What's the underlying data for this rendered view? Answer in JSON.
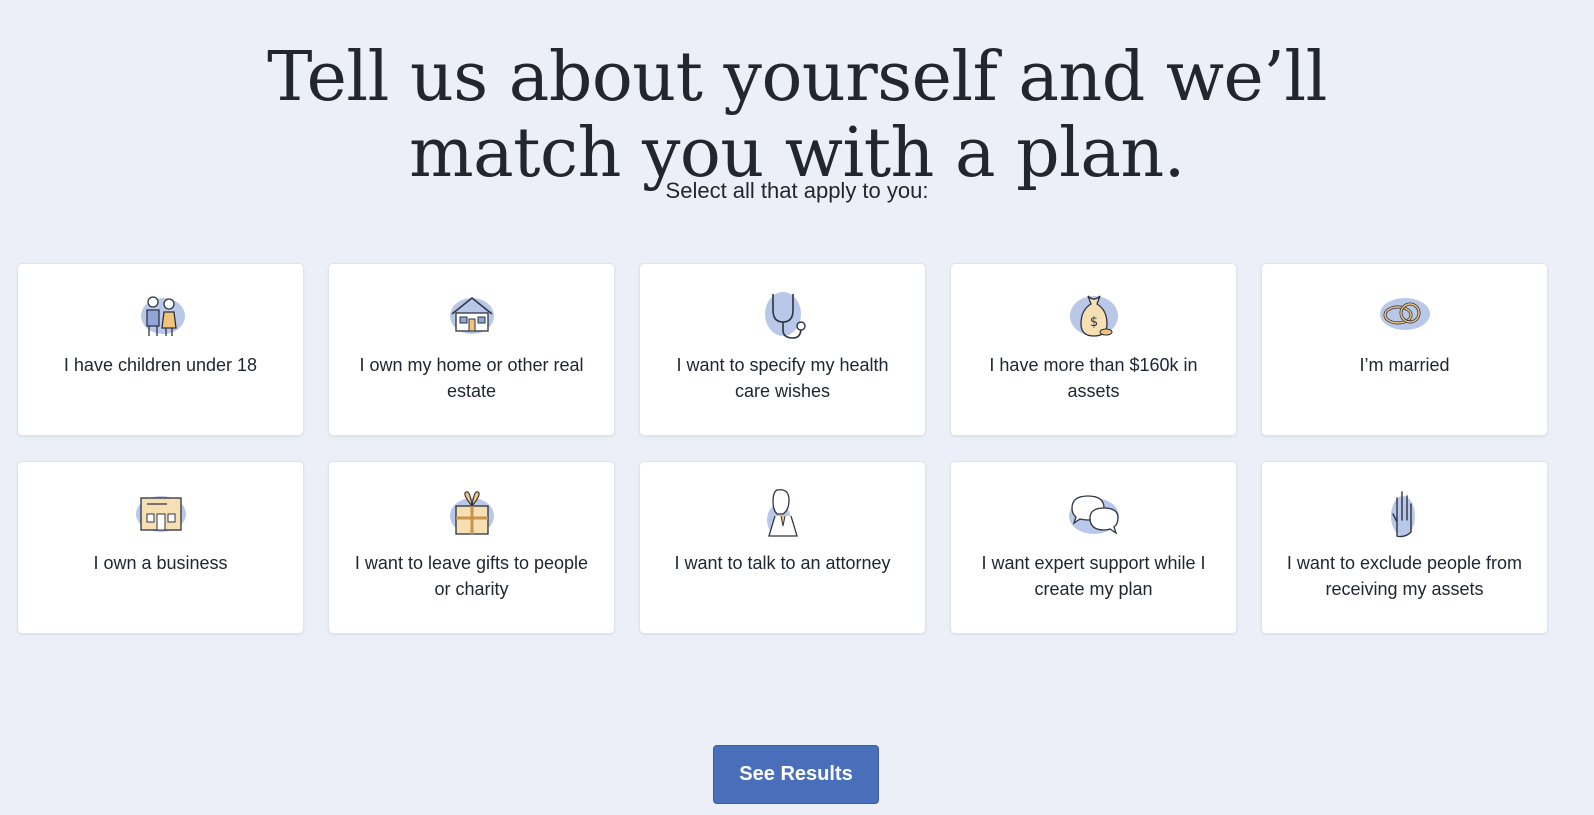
{
  "header": {
    "title_line1": "Tell us about yourself and we’ll",
    "title_line2": "match you with a plan.",
    "subtitle": "Select all that apply to you:"
  },
  "options": [
    {
      "label": "I have children under 18",
      "icon": "children-icon"
    },
    {
      "label": "I own my home or other real estate",
      "icon": "house-icon"
    },
    {
      "label": "I want to specify my health care wishes",
      "icon": "stethoscope-icon"
    },
    {
      "label": "I have more than $160k in assets",
      "icon": "money-bag-icon"
    },
    {
      "label": "I’m married",
      "icon": "wedding-rings-icon"
    },
    {
      "label": "I own a business",
      "icon": "storefront-icon"
    },
    {
      "label": "I want to leave gifts to people or charity",
      "icon": "gift-icon"
    },
    {
      "label": "I want to talk to an attorney",
      "icon": "attorney-icon"
    },
    {
      "label": "I want expert support while I create my plan",
      "icon": "chat-bubbles-icon"
    },
    {
      "label": "I want to exclude people from receiving my assets",
      "icon": "raised-hand-icon"
    }
  ],
  "cta": {
    "label": "See Results"
  },
  "colors": {
    "background": "#ECEFF8",
    "accent": "#4A6FBA",
    "icon_blob": "#B9C8E8",
    "icon_fill": "#F6DFB3"
  }
}
